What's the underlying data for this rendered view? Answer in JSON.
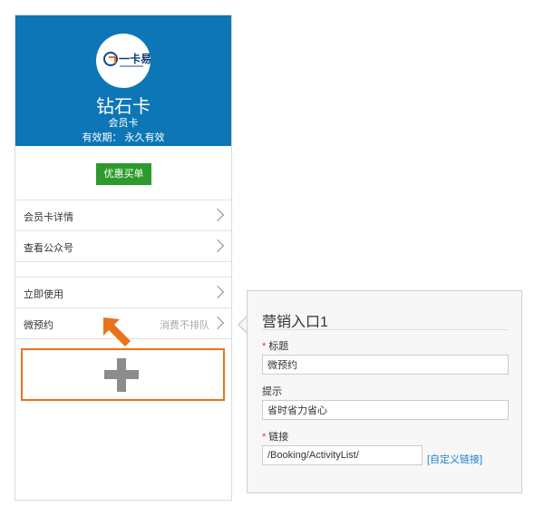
{
  "card": {
    "logo_text": "一卡易",
    "name": "钻石卡",
    "type": "会员卡",
    "validity": "有效期： 永久有效",
    "buy_button": "优惠买单"
  },
  "menu": [
    {
      "label": "会员卡详情",
      "hint": ""
    },
    {
      "label": "查看公众号",
      "hint": ""
    },
    {
      "label": "立即使用",
      "hint": ""
    },
    {
      "label": "微预约",
      "hint": "消费不排队"
    }
  ],
  "panel": {
    "title": "营销入口1",
    "fields": {
      "title_label": "标题",
      "title_value": "微预约",
      "hint_label": "提示",
      "hint_value": "省时省力省心",
      "link_label": "链接",
      "link_value": "/Booking/ActivityList/",
      "custom_link": "[自定义链接]"
    }
  },
  "colors": {
    "header": "#0c76b6",
    "buy_button": "#2c9a2c",
    "highlight": "#e8731b",
    "required": "#e23b3b",
    "link": "#1e7fc7"
  },
  "icons": [
    "chevron-right-icon",
    "plus-icon",
    "arrow-icon"
  ]
}
